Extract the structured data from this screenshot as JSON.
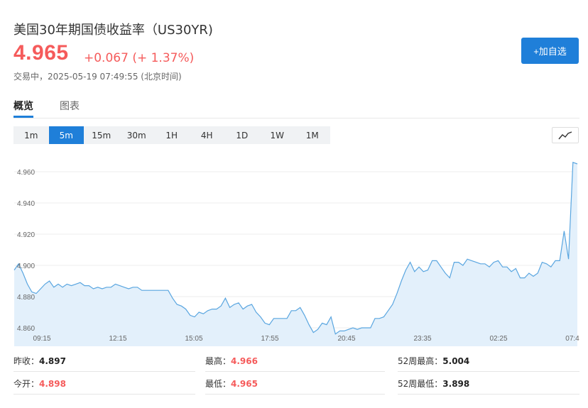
{
  "header": {
    "title": "美国30年期国债收益率（US30YR)",
    "price": "4.965",
    "change": "+0.067 (+ 1.37%)",
    "status": "交易中，2025-05-19 07:49:55 (北京时间)",
    "add_label": "+加自选"
  },
  "tabs": [
    {
      "label": "概览",
      "active": true
    },
    {
      "label": "图表",
      "active": false
    }
  ],
  "periods": [
    {
      "label": "1m",
      "active": false
    },
    {
      "label": "5m",
      "active": true
    },
    {
      "label": "15m",
      "active": false
    },
    {
      "label": "30m",
      "active": false
    },
    {
      "label": "1H",
      "active": false
    },
    {
      "label": "4H",
      "active": false
    },
    {
      "label": "1D",
      "active": false
    },
    {
      "label": "1W",
      "active": false
    },
    {
      "label": "1M",
      "active": false
    }
  ],
  "chart_toggle_icon": "line-chart-icon",
  "colors": {
    "accent": "#1f7fd9",
    "up": "#f55b5b",
    "line": "#5aa6e0",
    "fill": "#e3f0fb"
  },
  "chart_data": {
    "type": "area",
    "title": "",
    "xlabel": "",
    "ylabel": "",
    "ylim": [
      4.855,
      4.968
    ],
    "yticks": [
      "4.960",
      "4.940",
      "4.920",
      "4.900",
      "4.880",
      "4.860"
    ],
    "xticks": [
      "09:15",
      "12:15",
      "15:05",
      "17:55",
      "20:45",
      "23:35",
      "02:25",
      "07:4"
    ],
    "grid": true,
    "series": [
      {
        "values": [
          4.897,
          4.901,
          4.895,
          4.888,
          4.883,
          4.882,
          4.885,
          4.888,
          4.89,
          4.886,
          4.888,
          4.886,
          4.888,
          4.887,
          4.888,
          4.889,
          4.887,
          4.887,
          4.885,
          4.886,
          4.885,
          4.886,
          4.886,
          4.888,
          4.887,
          4.886,
          4.885,
          4.886,
          4.886,
          4.884,
          4.884,
          4.884,
          4.884,
          4.884,
          4.884,
          4.884,
          4.879,
          4.875,
          4.874,
          4.872,
          4.868,
          4.867,
          4.87,
          4.869,
          4.871,
          4.872,
          4.872,
          4.874,
          4.879,
          4.873,
          4.875,
          4.876,
          4.872,
          4.874,
          4.875,
          4.87,
          4.867,
          4.863,
          4.862,
          4.866,
          4.866,
          4.866,
          4.866,
          4.871,
          4.871,
          4.873,
          4.868,
          4.862,
          4.857,
          4.859,
          4.863,
          4.862,
          4.867,
          4.856,
          4.858,
          4.858,
          4.859,
          4.86,
          4.859,
          4.86,
          4.86,
          4.86,
          4.866,
          4.866,
          4.867,
          4.871,
          4.875,
          4.882,
          4.89,
          4.897,
          4.902,
          4.896,
          4.899,
          4.896,
          4.897,
          4.903,
          4.903,
          4.899,
          4.895,
          4.892,
          4.902,
          4.902,
          4.9,
          4.904,
          4.903,
          4.902,
          4.901,
          4.901,
          4.899,
          4.902,
          4.903,
          4.899,
          4.899,
          4.896,
          4.898,
          4.892,
          4.892,
          4.895,
          4.893,
          4.895,
          4.902,
          4.901,
          4.899,
          4.903,
          4.903,
          4.922,
          4.904,
          4.966,
          4.965
        ]
      }
    ]
  },
  "stats": [
    [
      {
        "label": "昨收：",
        "value": "4.897",
        "red": false
      },
      {
        "label": "最高：",
        "value": "4.966",
        "red": true
      },
      {
        "label": "52周最高：",
        "value": "5.004",
        "red": false
      }
    ],
    [
      {
        "label": "今开：",
        "value": "4.898",
        "red": true
      },
      {
        "label": "最低：",
        "value": "4.965",
        "red": true
      },
      {
        "label": "52周最低：",
        "value": "3.898",
        "red": false
      }
    ]
  ]
}
